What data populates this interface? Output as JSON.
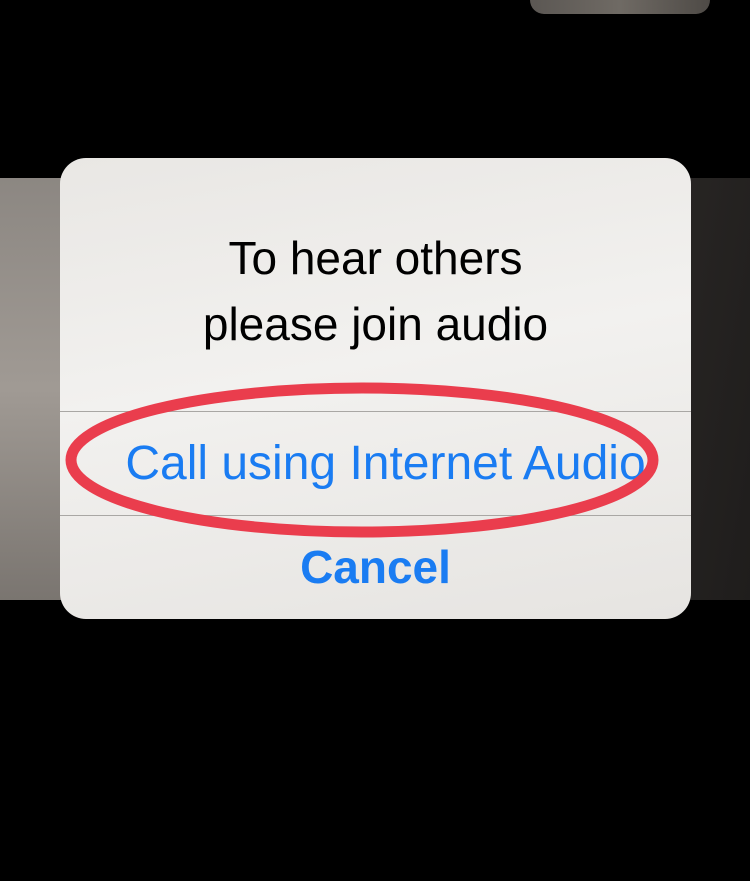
{
  "alert": {
    "title_line1": "To hear others",
    "title_line2": "please join audio",
    "primary_action_label": "Call using Internet Audio",
    "cancel_label": "Cancel"
  },
  "colors": {
    "button_text": "#1a7cf2",
    "annotation_ring": "#ea3d4d",
    "alert_background": "#efeeec",
    "screen_background": "#000000"
  },
  "annotation": {
    "type": "red-oval-highlight",
    "target": "call-using-internet-audio-button"
  }
}
